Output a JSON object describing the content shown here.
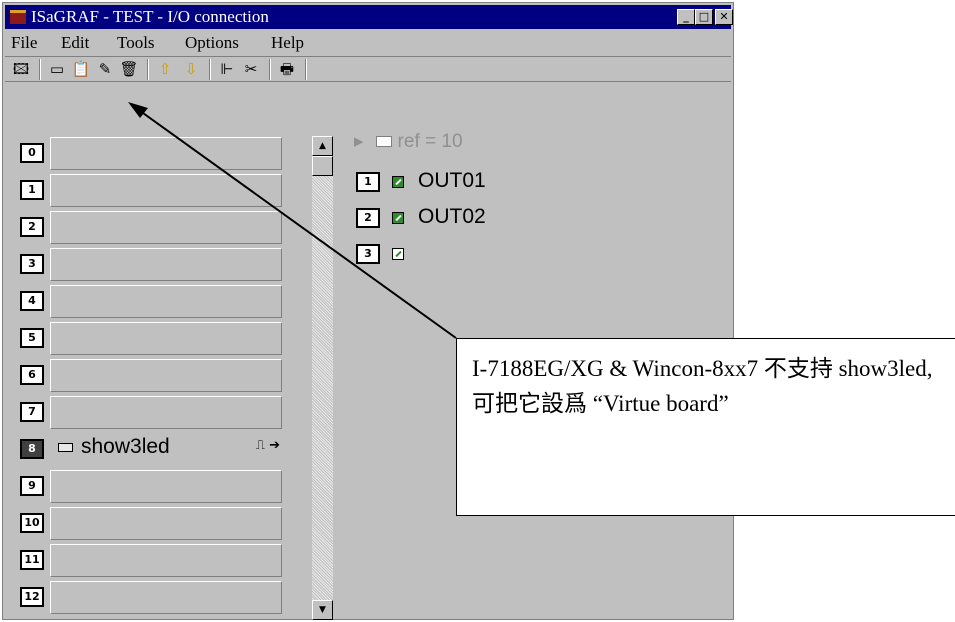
{
  "window": {
    "title": "ISaGRAF - TEST - I/O connection",
    "controls": {
      "minimize": "_",
      "maximize": "□",
      "close": "✕"
    }
  },
  "menu": [
    "File",
    "Edit",
    "Tools",
    "Options",
    "Help"
  ],
  "toolbar": {
    "icons": [
      "board-icon",
      "connect-icon",
      "open-board-icon",
      "edit-icon",
      "delete-icon",
      "move-up-icon",
      "move-down-icon",
      "tree-icon",
      "cut-icon",
      "print-icon"
    ],
    "glyphs": [
      "🖾",
      "▭",
      "📋",
      "✎",
      "🗑",
      "⇧",
      "⇩",
      "⊩",
      "✂",
      "🖶"
    ]
  },
  "slots": [
    {
      "num": "0",
      "board": ""
    },
    {
      "num": "1",
      "board": ""
    },
    {
      "num": "2",
      "board": ""
    },
    {
      "num": "3",
      "board": ""
    },
    {
      "num": "4",
      "board": ""
    },
    {
      "num": "5",
      "board": ""
    },
    {
      "num": "6",
      "board": ""
    },
    {
      "num": "7",
      "board": ""
    },
    {
      "num": "8",
      "board": "show3led",
      "selected": true
    },
    {
      "num": "9",
      "board": ""
    },
    {
      "num": "10",
      "board": ""
    },
    {
      "num": "11",
      "board": ""
    },
    {
      "num": "12",
      "board": ""
    }
  ],
  "slot_arrow": "⎍ ➔",
  "scroll": {
    "up": "▲",
    "down": "▼"
  },
  "channels": {
    "ref": "ref = 10",
    "arrow": "▸",
    "items": [
      {
        "num": "1",
        "name": "OUT01"
      },
      {
        "num": "2",
        "name": "OUT02"
      },
      {
        "num": "3",
        "name": ""
      }
    ]
  },
  "callout": {
    "text": "I-7188EG/XG & Wincon-8xx7 不支持 show3led, 可把它設爲 “Virtue board”"
  }
}
